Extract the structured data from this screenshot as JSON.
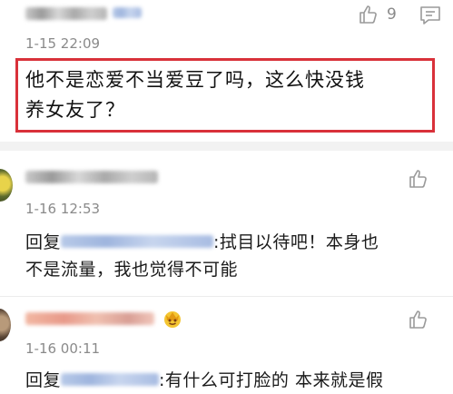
{
  "top_comment": {
    "like_count": "9",
    "timestamp": "1-15 22:09",
    "text_line1": "他不是恋爱不当爱豆了吗，这么快没钱",
    "text_line2": "养女友了？"
  },
  "reply_1": {
    "timestamp": "1-16 12:53",
    "prefix": "回复",
    "text_line1_suffix": ":拭目以待吧！本身也",
    "text_line2": "不是流量，我也觉得不可能"
  },
  "reply_2": {
    "timestamp": "1-16 00:11",
    "prefix": "回复",
    "text_line1_suffix": ":有什么可打脸的 本来就是假"
  },
  "colors": {
    "highlight_border": "#d9313a",
    "meta_text": "#8a8a8a",
    "icon_gray": "#9a9a9a"
  },
  "icons": [
    "thumbs-up-icon",
    "comment-icon",
    "crown-emoji-icon"
  ]
}
